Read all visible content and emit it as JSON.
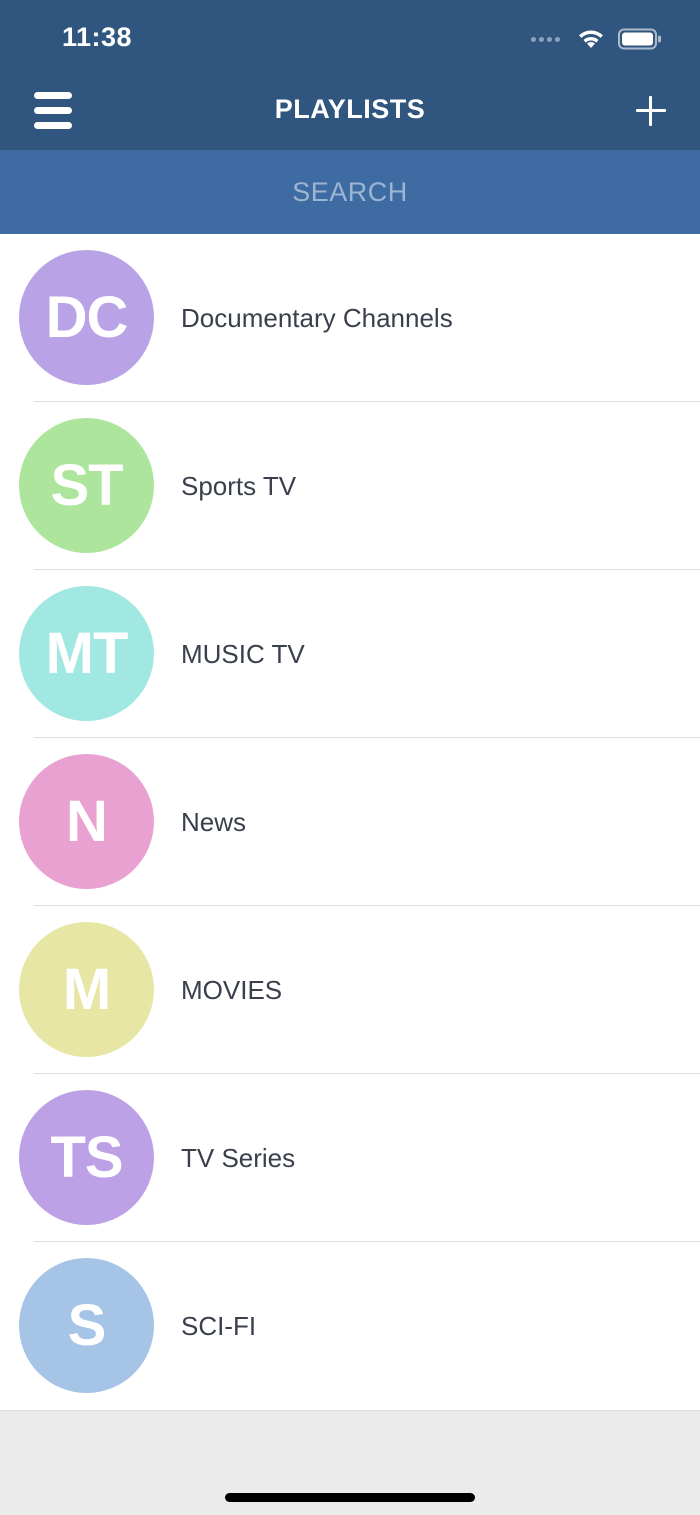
{
  "status_bar": {
    "time": "11:38"
  },
  "header": {
    "title": "PLAYLISTS",
    "background_color": "#30557f"
  },
  "search": {
    "placeholder": "SEARCH",
    "value": "",
    "background_color": "#3e6ba2"
  },
  "playlists": [
    {
      "initials": "DC",
      "name": "Documentary Channels",
      "color": "#b9a3e6"
    },
    {
      "initials": "ST",
      "name": "Sports TV",
      "color": "#ade59c"
    },
    {
      "initials": "MT",
      "name": "MUSIC TV",
      "color": "#a1e8e3"
    },
    {
      "initials": "N",
      "name": "News",
      "color": "#e8a1d0"
    },
    {
      "initials": "M",
      "name": "MOVIES",
      "color": "#e8e6a4"
    },
    {
      "initials": "TS",
      "name": "TV Series",
      "color": "#bda1e6"
    },
    {
      "initials": "S",
      "name": "SCI-FI",
      "color": "#a5c4e6"
    }
  ],
  "icons": {
    "menu": "hamburger-menu-icon",
    "add": "plus-icon",
    "wifi": "wifi-icon",
    "battery": "battery-icon",
    "signal": "cellular-signal-icon"
  }
}
